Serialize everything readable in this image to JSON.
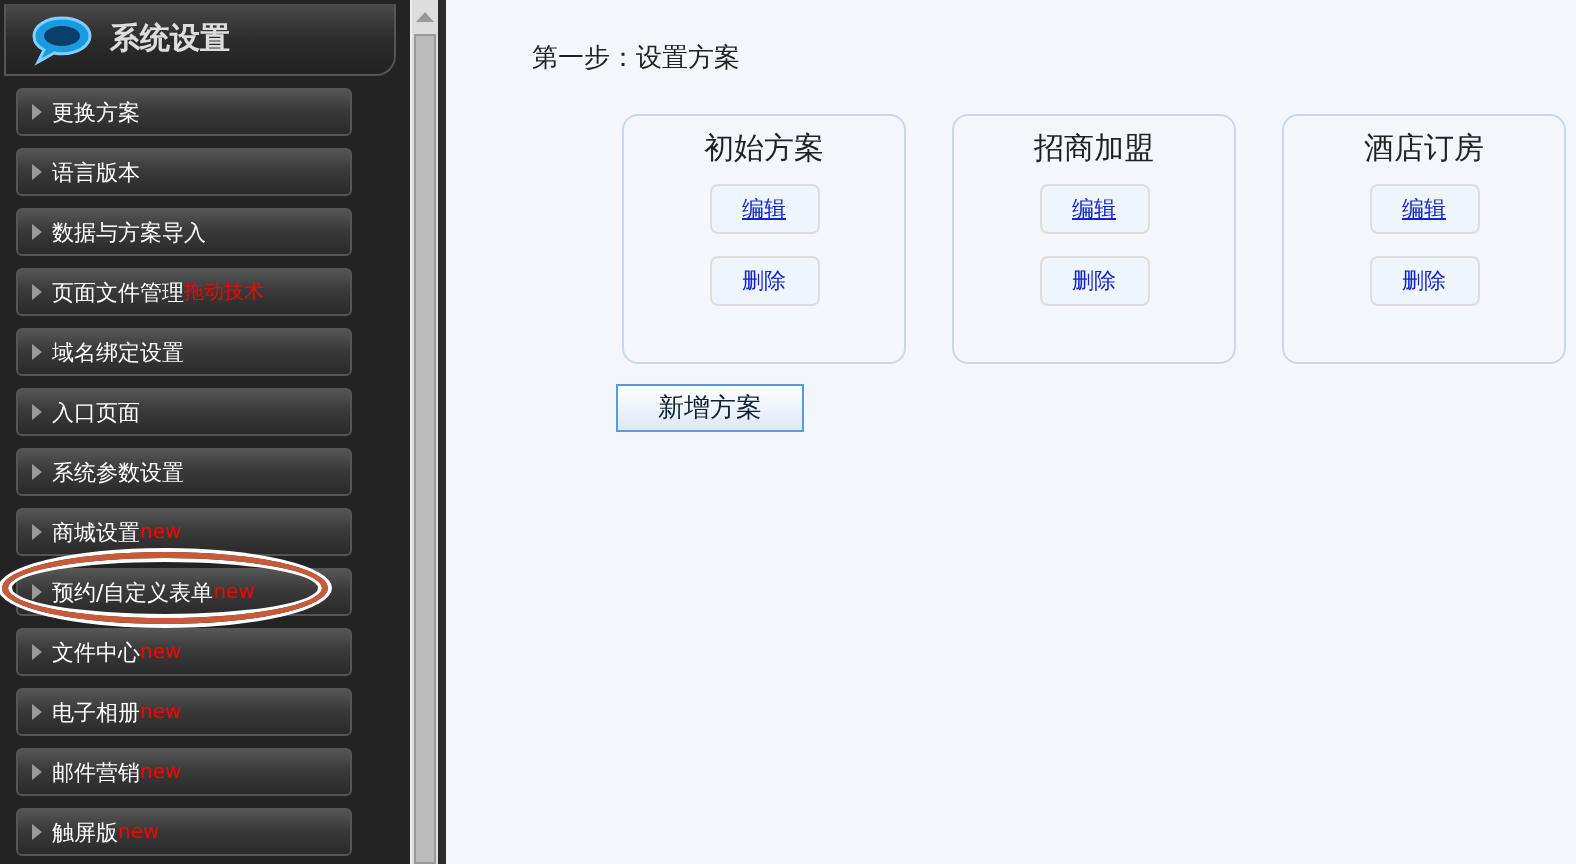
{
  "sidebar": {
    "title": "系统设置",
    "items": [
      {
        "label": "更换方案",
        "circled": false
      },
      {
        "label": "语言版本",
        "circled": false
      },
      {
        "label": "数据与方案导入",
        "circled": false
      },
      {
        "label": "页面文件管理",
        "badge": "拖动技术",
        "circled": false
      },
      {
        "label": "域名绑定设置",
        "circled": false
      },
      {
        "label": "入口页面",
        "circled": false
      },
      {
        "label": "系统参数设置",
        "circled": false
      },
      {
        "label": "商城设置",
        "badge": "new",
        "circled": false
      },
      {
        "label": "预约/自定义表单",
        "badge": "new",
        "circled": true
      },
      {
        "label": "文件中心",
        "badge": "new",
        "circled": false
      },
      {
        "label": "电子相册",
        "badge": "new",
        "circled": false
      },
      {
        "label": "邮件营销",
        "badge": "new",
        "circled": false
      },
      {
        "label": "触屏版",
        "badge": "new",
        "circled": false
      }
    ]
  },
  "main": {
    "heading": "第一步：设置方案",
    "schemes": [
      {
        "name": "初始方案",
        "edit": "编辑",
        "delete": "删除"
      },
      {
        "name": "招商加盟",
        "edit": "编辑",
        "delete": "删除"
      },
      {
        "name": "酒店订房",
        "edit": "编辑",
        "delete": "删除"
      }
    ],
    "add_button": "新增方案"
  }
}
